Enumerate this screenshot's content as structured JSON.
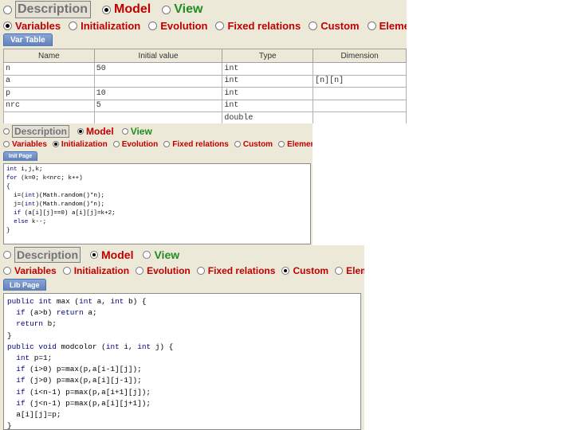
{
  "panels": [
    {
      "top": {
        "description": "Description",
        "model": "Model",
        "view": "View"
      },
      "subtabs": [
        "Variables",
        "Initialization",
        "Evolution",
        "Fixed relations",
        "Custom",
        "Elements"
      ],
      "selected_subtab": "Variables",
      "page_tab": "Var Table",
      "table": {
        "columns": [
          "Name",
          "Initial value",
          "Type",
          "Dimension"
        ],
        "rows": [
          [
            "n",
            "50",
            "int",
            ""
          ],
          [
            "a",
            "",
            "int",
            "[n][n]"
          ],
          [
            "p",
            "10",
            "int",
            ""
          ],
          [
            "nrc",
            "5",
            "int",
            ""
          ],
          [
            "",
            "",
            "double",
            ""
          ]
        ]
      }
    },
    {
      "top": {
        "description": "Description",
        "model": "Model",
        "view": "View"
      },
      "subtabs": [
        "Variables",
        "Initialization",
        "Evolution",
        "Fixed relations",
        "Custom",
        "Elements"
      ],
      "selected_subtab": "Initialization",
      "page_tab": "Init Page",
      "code_lines": [
        "int i,j,k;",
        "for (k=0; k<nrc; k++)",
        "{",
        "  i=(int)(Math.random()*n);",
        "  j=(int)(Math.random()*n);",
        "  if (a[i][j]==0) a[i][j]=k+2;",
        "  else k--;",
        "}"
      ]
    },
    {
      "top": {
        "description": "Description",
        "model": "Model",
        "view": "View"
      },
      "subtabs": [
        "Variables",
        "Initialization",
        "Evolution",
        "Fixed relations",
        "Custom",
        "Elements"
      ],
      "selected_subtab": "Custom",
      "page_tab": "Lib Page",
      "code_lines": [
        "public int max (int a, int b) {",
        "  if (a>b) return a;",
        "  return b;",
        "}",
        "public void modcolor (int i, int j) {",
        "  int p=1;",
        "  if (i>0) p=max(p,a[i-1][j]);",
        "  if (j>0) p=max(p,a[i][j-1]);",
        "  if (i<n-1) p=max(p,a[i+1][j]);",
        "  if (j<n-1) p=max(p,a[i][j+1]);",
        "  a[i][j]=p;",
        "}"
      ]
    }
  ]
}
